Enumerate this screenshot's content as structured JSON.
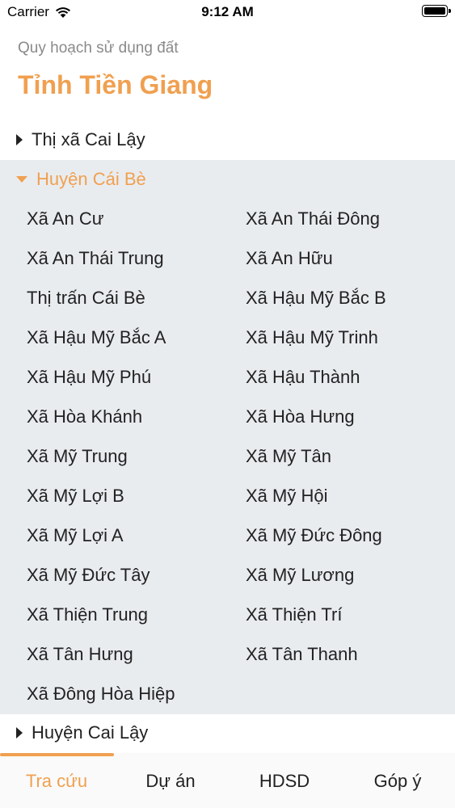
{
  "status_bar": {
    "carrier": "Carrier",
    "time": "9:12 AM"
  },
  "header": {
    "subtitle": "Quy hoạch sử dụng đất",
    "title": "Tỉnh Tiền Giang"
  },
  "groups": [
    {
      "label": "Thị xã Cai Lậy",
      "expanded": false
    },
    {
      "label": "Huyện Cái Bè",
      "expanded": true
    },
    {
      "label": "Huyện Cai Lậy",
      "expanded": false
    }
  ],
  "wards": [
    "Xã An Cư",
    "Xã An Thái Đông",
    "Xã An Thái Trung",
    "Xã An Hữu",
    "Thị trấn Cái Bè",
    "Xã Hậu Mỹ Bắc B",
    "Xã Hậu Mỹ Bắc A",
    "Xã Hậu Mỹ Trinh",
    "Xã Hậu Mỹ Phú",
    "Xã Hậu Thành",
    "Xã Hòa Khánh",
    "Xã Hòa Hưng",
    "Xã Mỹ Trung",
    "Xã Mỹ Tân",
    "Xã Mỹ Lợi B",
    "Xã Mỹ Hội",
    "Xã Mỹ Lợi A",
    "Xã Mỹ Đức Đông",
    "Xã Mỹ Đức Tây",
    "Xã Mỹ Lương",
    "Xã Thiện Trung",
    "Xã Thiện Trí",
    "Xã Tân Hưng",
    "Xã Tân Thanh",
    "Xã Đông Hòa Hiệp"
  ],
  "tabs": [
    {
      "label": "Tra cứu",
      "active": true
    },
    {
      "label": "Dự án",
      "active": false
    },
    {
      "label": "HDSD",
      "active": false
    },
    {
      "label": "Góp ý",
      "active": false
    }
  ],
  "colors": {
    "accent": "#f0a050",
    "panel_bg": "#e9ecef"
  }
}
